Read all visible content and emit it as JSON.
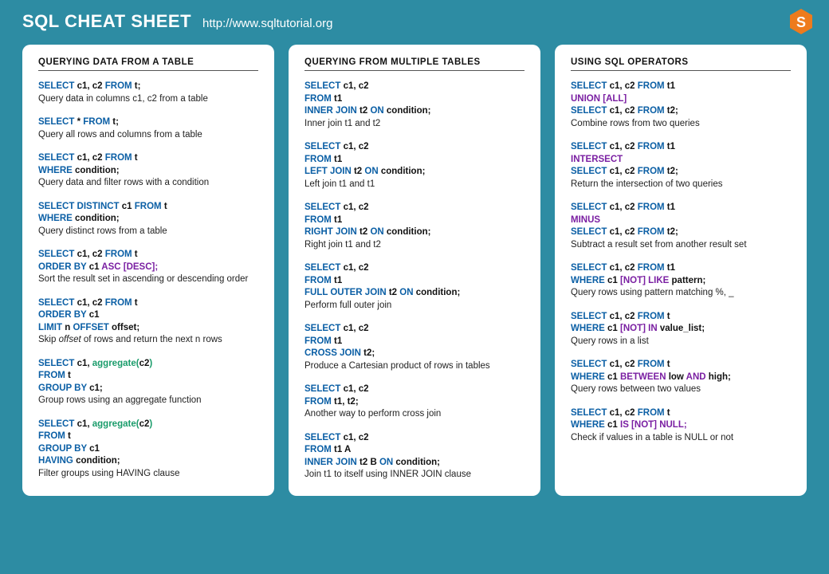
{
  "header": {
    "title": "SQL CHEAT SHEET",
    "url": "http://www.sqltutorial.org"
  },
  "columns": [
    {
      "title": "QUERYING DATA FROM A TABLE",
      "snippets": [
        {
          "lines": [
            [
              [
                "kw",
                "SELECT"
              ],
              [
                "t",
                " c1, c2 "
              ],
              [
                "kw",
                "FROM"
              ],
              [
                "t",
                " t;"
              ]
            ]
          ],
          "desc": "Query data in columns c1, c2 from a table"
        },
        {
          "lines": [
            [
              [
                "kw",
                "SELECT"
              ],
              [
                "t",
                " * "
              ],
              [
                "kw",
                "FROM"
              ],
              [
                "t",
                " t;"
              ]
            ]
          ],
          "desc": "Query all rows and columns from a table"
        },
        {
          "lines": [
            [
              [
                "kw",
                "SELECT"
              ],
              [
                "t",
                " c1, c2 "
              ],
              [
                "kw",
                "FROM"
              ],
              [
                "t",
                " t"
              ]
            ],
            [
              [
                "kw",
                "WHERE"
              ],
              [
                "t",
                " condition;"
              ]
            ]
          ],
          "desc": "Query data and filter rows with a condition"
        },
        {
          "lines": [
            [
              [
                "kw",
                "SELECT DISTINCT"
              ],
              [
                "t",
                " c1 "
              ],
              [
                "kw",
                "FROM"
              ],
              [
                "t",
                " t"
              ]
            ],
            [
              [
                "kw",
                "WHERE"
              ],
              [
                "t",
                " condition;"
              ]
            ]
          ],
          "desc": "Query distinct rows from a table"
        },
        {
          "lines": [
            [
              [
                "kw",
                "SELECT"
              ],
              [
                "t",
                " c1, c2 "
              ],
              [
                "kw",
                "FROM"
              ],
              [
                "t",
                " t"
              ]
            ],
            [
              [
                "kw",
                "ORDER BY"
              ],
              [
                "t",
                " c1 "
              ],
              [
                "op",
                "ASC [DESC];"
              ]
            ]
          ],
          "desc": "Sort the result set in ascending or descending order"
        },
        {
          "lines": [
            [
              [
                "kw",
                "SELECT"
              ],
              [
                "t",
                " c1, c2 "
              ],
              [
                "kw",
                "FROM"
              ],
              [
                "t",
                " t"
              ]
            ],
            [
              [
                "kw",
                "ORDER BY"
              ],
              [
                "t",
                " c1"
              ]
            ],
            [
              [
                "kw",
                "LIMIT"
              ],
              [
                "t",
                " n "
              ],
              [
                "kw",
                "OFFSET"
              ],
              [
                "t",
                " offset;"
              ]
            ]
          ],
          "desc": "Skip <em>offset</em> of rows and return the next n rows"
        },
        {
          "lines": [
            [
              [
                "kw",
                "SELECT"
              ],
              [
                "t",
                " c1, "
              ],
              [
                "fn",
                "aggregate("
              ],
              [
                "t",
                "c2"
              ],
              [
                "fn",
                ")"
              ]
            ],
            [
              [
                "kw",
                "FROM"
              ],
              [
                "t",
                " t"
              ]
            ],
            [
              [
                "kw",
                "GROUP BY"
              ],
              [
                "t",
                " c1;"
              ]
            ]
          ],
          "desc": "Group rows using an aggregate function"
        },
        {
          "lines": [
            [
              [
                "kw",
                "SELECT"
              ],
              [
                "t",
                " c1, "
              ],
              [
                "fn",
                "aggregate("
              ],
              [
                "t",
                "c2"
              ],
              [
                "fn",
                ")"
              ]
            ],
            [
              [
                "kw",
                "FROM"
              ],
              [
                "t",
                " t"
              ]
            ],
            [
              [
                "kw",
                "GROUP BY"
              ],
              [
                "t",
                " c1"
              ]
            ],
            [
              [
                "kw",
                "HAVING"
              ],
              [
                "t",
                " condition;"
              ]
            ]
          ],
          "desc": "Filter groups using HAVING clause"
        }
      ]
    },
    {
      "title": "QUERYING FROM MULTIPLE TABLES",
      "snippets": [
        {
          "lines": [
            [
              [
                "kw",
                "SELECT"
              ],
              [
                "t",
                " c1, c2"
              ]
            ],
            [
              [
                "kw",
                "FROM"
              ],
              [
                "t",
                " t1"
              ]
            ],
            [
              [
                "kw",
                "INNER JOIN"
              ],
              [
                "t",
                " t2 "
              ],
              [
                "kw",
                "ON"
              ],
              [
                "t",
                " condition;"
              ]
            ]
          ],
          "desc": "Inner join t1 and t2"
        },
        {
          "lines": [
            [
              [
                "kw",
                "SELECT"
              ],
              [
                "t",
                " c1, c2"
              ]
            ],
            [
              [
                "kw",
                "FROM"
              ],
              [
                "t",
                " t1"
              ]
            ],
            [
              [
                "kw",
                "LEFT JOIN"
              ],
              [
                "t",
                " t2 "
              ],
              [
                "kw",
                "ON"
              ],
              [
                "t",
                " condition;"
              ]
            ]
          ],
          "desc": "Left join t1 and t1"
        },
        {
          "lines": [
            [
              [
                "kw",
                "SELECT"
              ],
              [
                "t",
                " c1, c2"
              ]
            ],
            [
              [
                "kw",
                "FROM"
              ],
              [
                "t",
                " t1"
              ]
            ],
            [
              [
                "kw",
                "RIGHT JOIN"
              ],
              [
                "t",
                " t2 "
              ],
              [
                "kw",
                "ON"
              ],
              [
                "t",
                " condition;"
              ]
            ]
          ],
          "desc": "Right join t1 and t2"
        },
        {
          "lines": [
            [
              [
                "kw",
                "SELECT"
              ],
              [
                "t",
                " c1, c2"
              ]
            ],
            [
              [
                "kw",
                "FROM"
              ],
              [
                "t",
                " t1"
              ]
            ],
            [
              [
                "kw",
                "FULL OUTER JOIN"
              ],
              [
                "t",
                " t2 "
              ],
              [
                "kw",
                "ON"
              ],
              [
                "t",
                " condition;"
              ]
            ]
          ],
          "desc": "Perform full outer join"
        },
        {
          "lines": [
            [
              [
                "kw",
                "SELECT"
              ],
              [
                "t",
                " c1, c2"
              ]
            ],
            [
              [
                "kw",
                "FROM"
              ],
              [
                "t",
                " t1"
              ]
            ],
            [
              [
                "kw",
                "CROSS JOIN"
              ],
              [
                "t",
                " t2;"
              ]
            ]
          ],
          "desc": "Produce a Cartesian product of rows in tables"
        },
        {
          "lines": [
            [
              [
                "kw",
                "SELECT"
              ],
              [
                "t",
                " c1, c2"
              ]
            ],
            [
              [
                "kw",
                "FROM"
              ],
              [
                "t",
                " t1, t2"
              ],
              [
                "t",
                ";"
              ]
            ]
          ],
          "desc": "Another way to perform cross join"
        },
        {
          "lines": [
            [
              [
                "kw",
                "SELECT"
              ],
              [
                "t",
                " c1, c2"
              ]
            ],
            [
              [
                "kw",
                "FROM"
              ],
              [
                "t",
                " t1 A"
              ]
            ],
            [
              [
                "kw",
                "INNER JOIN"
              ],
              [
                "t",
                " t2 B "
              ],
              [
                "kw",
                "ON"
              ],
              [
                "t",
                " condition;"
              ]
            ]
          ],
          "desc": "Join t1 to itself using INNER JOIN clause"
        }
      ]
    },
    {
      "title": "USING SQL OPERATORS",
      "snippets": [
        {
          "lines": [
            [
              [
                "kw",
                "SELECT"
              ],
              [
                "t",
                " c1, c2 "
              ],
              [
                "kw",
                "FROM"
              ],
              [
                "t",
                " t1"
              ]
            ],
            [
              [
                "op",
                "UNION [ALL]"
              ]
            ],
            [
              [
                "kw",
                "SELECT"
              ],
              [
                "t",
                " c1, c2 "
              ],
              [
                "kw",
                "FROM"
              ],
              [
                "t",
                " t2;"
              ]
            ]
          ],
          "desc": "Combine rows from two queries"
        },
        {
          "lines": [
            [
              [
                "kw",
                "SELECT"
              ],
              [
                "t",
                " c1, c2 "
              ],
              [
                "kw",
                "FROM"
              ],
              [
                "t",
                " t1"
              ]
            ],
            [
              [
                "op",
                "INTERSECT"
              ]
            ],
            [
              [
                "kw",
                "SELECT"
              ],
              [
                "t",
                " c1, c2 "
              ],
              [
                "kw",
                "FROM"
              ],
              [
                "t",
                " t2;"
              ]
            ]
          ],
          "desc": "Return the intersection of two queries"
        },
        {
          "lines": [
            [
              [
                "kw",
                "SELECT"
              ],
              [
                "t",
                " c1, c2 "
              ],
              [
                "kw",
                "FROM"
              ],
              [
                "t",
                " t1"
              ]
            ],
            [
              [
                "op",
                "MINUS"
              ]
            ],
            [
              [
                "kw",
                "SELECT"
              ],
              [
                "t",
                " c1, c2 "
              ],
              [
                "kw",
                "FROM"
              ],
              [
                "t",
                " t2;"
              ]
            ]
          ],
          "desc": "Subtract a result set from another result set"
        },
        {
          "lines": [
            [
              [
                "kw",
                "SELECT"
              ],
              [
                "t",
                " c1, c2 "
              ],
              [
                "kw",
                "FROM"
              ],
              [
                "t",
                " t1"
              ]
            ],
            [
              [
                "kw",
                "WHERE"
              ],
              [
                "t",
                " c1 "
              ],
              [
                "op",
                "[NOT] LIKE"
              ],
              [
                "t",
                " pattern;"
              ]
            ]
          ],
          "desc": "Query rows using pattern matching %, _"
        },
        {
          "lines": [
            [
              [
                "kw",
                "SELECT"
              ],
              [
                "t",
                " c1, c2 "
              ],
              [
                "kw",
                "FROM"
              ],
              [
                "t",
                " t"
              ]
            ],
            [
              [
                "kw",
                "WHERE"
              ],
              [
                "t",
                " c1 "
              ],
              [
                "op",
                "[NOT] IN"
              ],
              [
                "t",
                " value_list;"
              ]
            ]
          ],
          "desc": "Query rows in a list"
        },
        {
          "lines": [
            [
              [
                "kw",
                "SELECT"
              ],
              [
                "t",
                " c1, c2 "
              ],
              [
                "kw",
                "FROM"
              ],
              [
                "t",
                " t"
              ]
            ],
            [
              [
                "kw",
                "WHERE "
              ],
              [
                "t",
                " c1 "
              ],
              [
                "op",
                "BETWEEN"
              ],
              [
                "t",
                " low "
              ],
              [
                "op",
                "AND"
              ],
              [
                "t",
                " high;"
              ]
            ]
          ],
          "desc": "Query rows between two values"
        },
        {
          "lines": [
            [
              [
                "kw",
                "SELECT"
              ],
              [
                "t",
                " c1, c2 "
              ],
              [
                "kw",
                "FROM"
              ],
              [
                "t",
                " t"
              ]
            ],
            [
              [
                "kw",
                "WHERE "
              ],
              [
                "t",
                " c1 "
              ],
              [
                "op",
                "IS [NOT] NULL;"
              ]
            ]
          ],
          "desc": "Check if values in a table is NULL or not"
        }
      ]
    }
  ]
}
